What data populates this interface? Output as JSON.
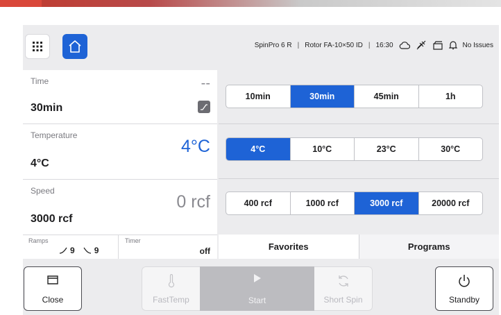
{
  "header": {
    "device": "SpinPro 6 R",
    "rotor": "Rotor FA-10×50 ID",
    "clock": "16:30",
    "issues": "No Issues",
    "icons": [
      "apps-grid-icon",
      "home-icon",
      "cloud-icon",
      "no-usb-icon",
      "lid-icon",
      "bell-icon"
    ]
  },
  "params": {
    "time": {
      "label": "Time",
      "value": "30min",
      "current": "--"
    },
    "temperature": {
      "label": "Temperature",
      "value": "4°C",
      "current": "4°C"
    },
    "speed": {
      "label": "Speed",
      "value": "3000 rcf",
      "current": "0 rcf"
    },
    "ramps": {
      "label": "Ramps",
      "up": "9",
      "down": "9"
    },
    "timer": {
      "label": "Timer",
      "value": "off"
    }
  },
  "presets": {
    "time": {
      "options": [
        "10min",
        "30min",
        "45min",
        "1h"
      ],
      "selected": "30min"
    },
    "temperature": {
      "options": [
        "4°C",
        "10°C",
        "23°C",
        "30°C"
      ],
      "selected": "4°C"
    },
    "speed": {
      "options": [
        "400 rcf",
        "1000 rcf",
        "3000 rcf",
        "20000 rcf"
      ],
      "selected": "3000 rcf"
    }
  },
  "tabs": {
    "favorites": "Favorites",
    "programs": "Programs"
  },
  "actions": {
    "close": "Close",
    "fasttemp": "FastTemp",
    "start": "Start",
    "short_spin": "Short Spin",
    "standby": "Standby"
  },
  "colors": {
    "accent": "#1e63d6",
    "disabled": "#bcbcc0"
  }
}
